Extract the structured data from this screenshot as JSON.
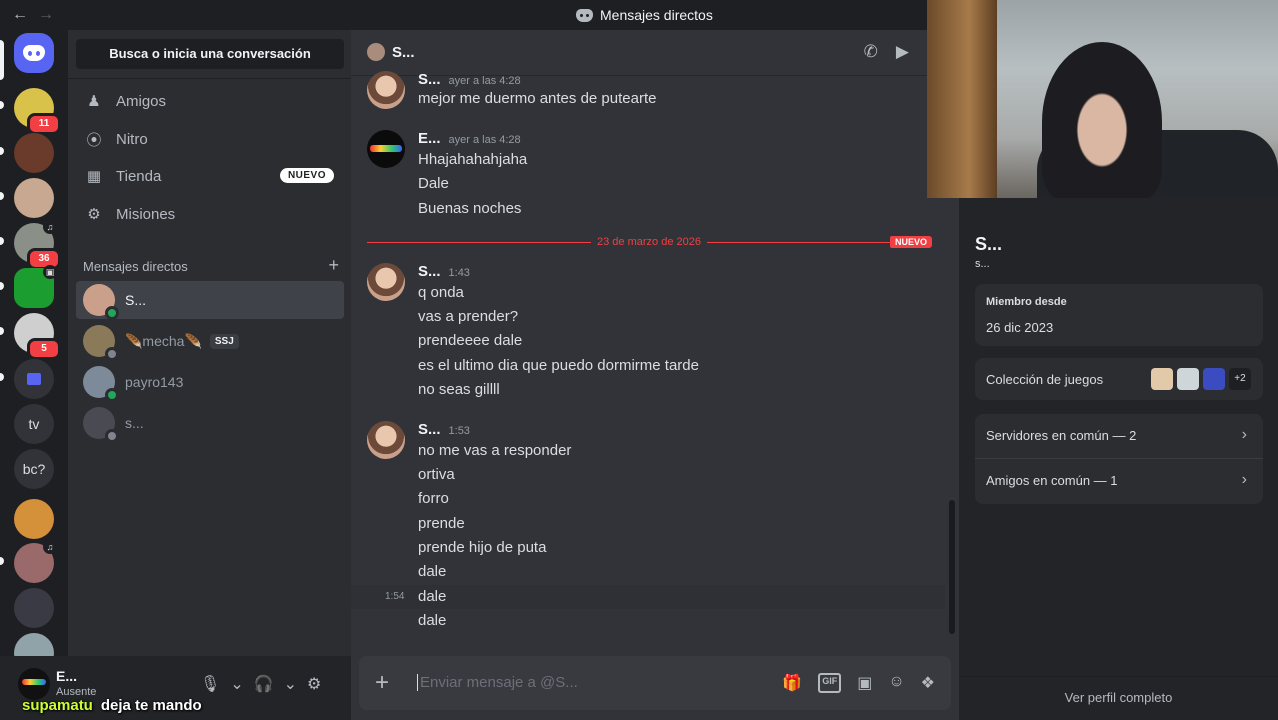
{
  "window": {
    "title": "Mensajes directos"
  },
  "rail": {
    "servers": [
      {
        "badge": "11",
        "color": "#d9c24a"
      },
      {
        "badge": "",
        "color": "#6a3a2a"
      },
      {
        "badge": "",
        "color": "#c8a890"
      },
      {
        "badge": "36",
        "color": "#8a8f88"
      },
      {
        "badge": "",
        "color": "#1b9d2f"
      },
      {
        "badge": "5",
        "color": "#cfcfcf"
      }
    ],
    "text_servers": [
      "tv",
      "bc?"
    ]
  },
  "sidebar": {
    "search_label": "Busca o inicia una conversación",
    "nav": [
      {
        "label": "Amigos",
        "icon": "friends-icon"
      },
      {
        "label": "Nitro",
        "icon": "nitro-icon"
      },
      {
        "label": "Tienda",
        "icon": "shop-icon",
        "badge": "NUEVO"
      },
      {
        "label": "Misiones",
        "icon": "quests-icon"
      }
    ],
    "dm_header": "Mensajes directos",
    "dms": [
      {
        "name": "S...",
        "status": "online",
        "color": "#caa08a"
      },
      {
        "name": "🪶mecha🪶",
        "status": "offline",
        "tag": "SSJ",
        "color": "#8a7a5a"
      },
      {
        "name": "payro143",
        "status": "online",
        "color": "#7c8a9a"
      },
      {
        "name": "s...",
        "status": "offline",
        "color": "#4a4a52"
      }
    ]
  },
  "user_panel": {
    "name": "E...",
    "status": "Ausente"
  },
  "caption": {
    "name": "supamatu",
    "text": "deja te mando"
  },
  "chat": {
    "header_name": "S...",
    "groups": [
      {
        "author": "S...",
        "time": "ayer a las 4:28",
        "lines": [
          "mejor me duermo antes de putearte"
        ]
      },
      {
        "author": "E...",
        "time": "ayer a las 4:28",
        "lines": [
          "Hhajahahahjaha",
          "Dale",
          "Buenas noches"
        ]
      },
      {
        "author": "S...",
        "time": "1:43",
        "lines": [
          "q onda",
          "vas a prender?",
          "prendeeee dale",
          "es el ultimo dia que puedo dormirme tarde",
          "no seas gillll"
        ]
      },
      {
        "author": "S...",
        "time": "1:53",
        "lines": [
          "no me vas a responder",
          "ortiva",
          "forro",
          "prende",
          "prende hijo de puta",
          "dale",
          "dale",
          "dale"
        ]
      }
    ],
    "divider_date": "23 de marzo de 2026",
    "divider_new": "NUEVO",
    "hover_time": "1:54",
    "composer_placeholder": "Enviar mensaje a @S..."
  },
  "profile": {
    "name": "S...",
    "username": "s...",
    "member_since_label": "Miembro desde",
    "member_since": "26 dic 2023",
    "games_label": "Colección de juegos",
    "games_more": "+2",
    "servers_common": "Servidores en común — 2",
    "friends_common": "Amigos en común — 1",
    "view_full": "Ver perfil completo"
  },
  "colors": {
    "accent": "#5865f2",
    "danger": "#f23f43",
    "online": "#23a55a"
  }
}
